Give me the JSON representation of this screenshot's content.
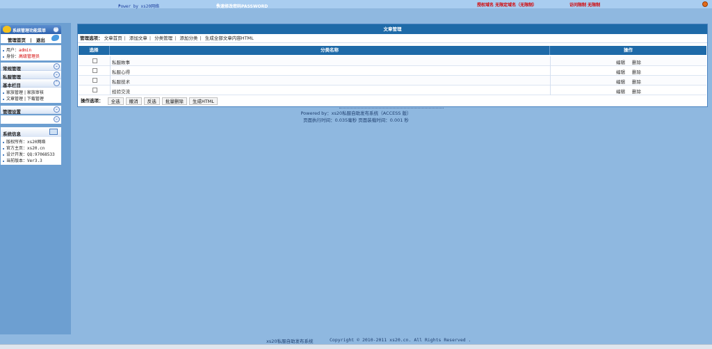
{
  "topbar": {
    "power": "Power by xs20网络",
    "password": "快速修改密码PASSWORD",
    "domain": "授权域名 无限定域名（无限制）",
    "visits": "访问限制 无限制"
  },
  "sidebar": {
    "header": "系统管理功能菜单",
    "home": "管理首页",
    "separator": "|",
    "logout": "退出",
    "user_label": "用户：",
    "user_value": "admin",
    "role_label": "身份：",
    "role_value": "高级管理员",
    "sections": [
      "常规管理",
      "私服管理",
      "基本栏目"
    ],
    "links_row1": [
      "家族管理",
      "家族审核"
    ],
    "links_row2": [
      "文章管理",
      "下载管理"
    ],
    "link_sep": "|",
    "settings": "管理设置",
    "info_title": "系统信息",
    "info": [
      {
        "label": "版权所有：",
        "value": "xs20网络"
      },
      {
        "label": "官方主页：",
        "value": "xs20.cn"
      },
      {
        "label": "设计开发：",
        "value": "QQ:97068533"
      },
      {
        "label": "当前版本：",
        "value": "Ver3.3"
      }
    ]
  },
  "main": {
    "title": "文章管理",
    "ops_label": "管理选项：",
    "ops": [
      "文章首页",
      "添加文章",
      "分类管理",
      "添加分类",
      "生成全部文章内容HTML"
    ],
    "ops_sep": "|",
    "columns": {
      "select": "选择",
      "name": "分类名称",
      "action": "操作"
    },
    "rows": [
      {
        "name": "私服故事",
        "edit": "编辑",
        "delete": "删除"
      },
      {
        "name": "私服心得",
        "edit": "编辑",
        "delete": "删除"
      },
      {
        "name": "私服技术",
        "edit": "编辑",
        "delete": "删除"
      },
      {
        "name": "经验交流",
        "edit": "编辑",
        "delete": "删除"
      }
    ],
    "actions_label": "操作选项：",
    "buttons": [
      "全选",
      "撤消",
      "反选",
      "批量删除",
      "生成HTML"
    ]
  },
  "footer": {
    "powered": "Powered by：xs20私服自助发布系统（ACCESS 版）",
    "timing": "页面执行时间：0.035毫秒  页面装载时间：0.001 秒",
    "system": "xs20私服自助发布系统",
    "copyright": "Copyright © 2010-2011 xs20.cn. All Rights Reserved ."
  }
}
